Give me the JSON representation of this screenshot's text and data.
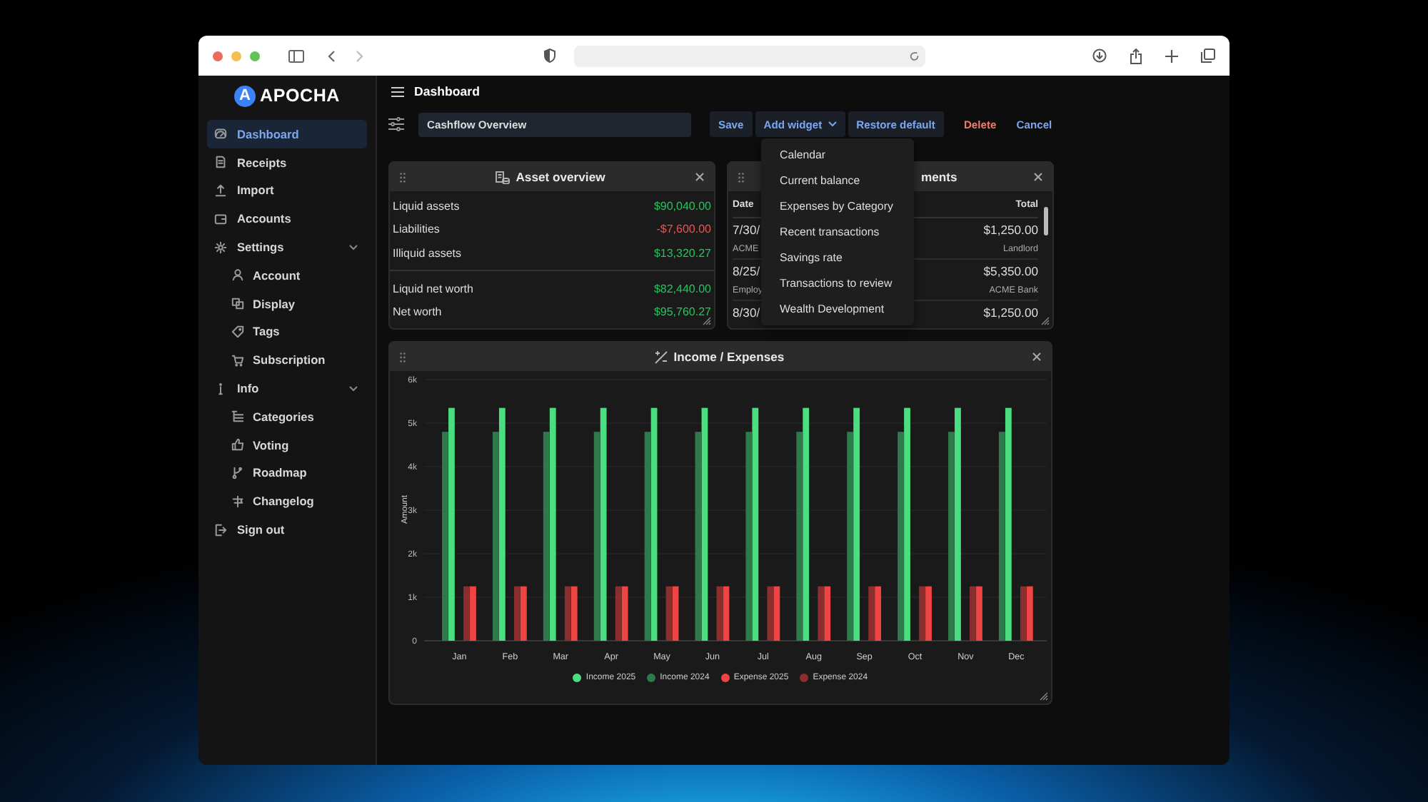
{
  "app": {
    "logo_letter": "A",
    "logo_text": "APOCHA"
  },
  "sidebar": {
    "items": [
      {
        "label": "Dashboard",
        "selected": true
      },
      {
        "label": "Receipts",
        "selected": false
      },
      {
        "label": "Import",
        "selected": false
      },
      {
        "label": "Accounts",
        "selected": false
      },
      {
        "label": "Settings",
        "selected": false,
        "expanded": true,
        "children": [
          {
            "label": "Account",
            "selected": false
          },
          {
            "label": "Display",
            "selected": false
          },
          {
            "label": "Tags",
            "selected": false
          },
          {
            "label": "Subscription",
            "selected": false
          }
        ]
      },
      {
        "label": "Info",
        "selected": false,
        "expanded": true,
        "children": [
          {
            "label": "Categories",
            "selected": false
          },
          {
            "label": "Voting",
            "selected": false
          },
          {
            "label": "Roadmap",
            "selected": false
          },
          {
            "label": "Changelog",
            "selected": false
          }
        ]
      },
      {
        "label": "Sign out",
        "selected": false
      }
    ]
  },
  "header": {
    "title": "Dashboard"
  },
  "toolbar": {
    "dashboard_name": "Cashflow Overview",
    "buttons": [
      {
        "label": "Save",
        "kind": "primary"
      },
      {
        "label": "Add widget",
        "kind": "menu"
      },
      {
        "label": "Restore default",
        "kind": "primary"
      },
      {
        "label": "Delete",
        "kind": "danger"
      },
      {
        "label": "Cancel",
        "kind": "link"
      }
    ]
  },
  "add_widget_menu": {
    "items": [
      "Calendar",
      "Current balance",
      "Expenses by Category",
      "Recent transactions",
      "Savings rate",
      "Transactions to review",
      "Wealth Development"
    ]
  },
  "asset_overview": {
    "title": "Asset overview",
    "groups": [
      [
        {
          "label": "Liquid assets",
          "value": "$90,040.00",
          "color": "#22c55e"
        },
        {
          "label": "Liabilities",
          "value": "-$7,600.00",
          "color": "#ef5350"
        },
        {
          "label": "Illiquid assets",
          "value": "$13,320.27",
          "color": "#22c55e"
        }
      ],
      [
        {
          "label": "Liquid net worth",
          "value": "$82,440.00",
          "color": "#22c55e"
        },
        {
          "label": "Net worth",
          "value": "$95,760.27",
          "color": "#22c55e"
        }
      ]
    ]
  },
  "payments": {
    "title": "ments",
    "columns": [
      "Date",
      "Total"
    ],
    "rows": [
      {
        "date": "7/30/",
        "total": "$1,250.00",
        "note": "ACME",
        "party": "Landlord"
      },
      {
        "date": "8/25/",
        "total": "$5,350.00",
        "note": "Employ",
        "party": "ACME Bank"
      },
      {
        "date": "8/30/",
        "total": "$1,250.00"
      }
    ]
  },
  "income_expenses": {
    "title": "Income / Expenses",
    "chart_data": {
      "type": "bar",
      "ylabel": "Amount",
      "categories": [
        "Jan",
        "Feb",
        "Mar",
        "Apr",
        "May",
        "Jun",
        "Jul",
        "Aug",
        "Sep",
        "Oct",
        "Nov",
        "Dec"
      ],
      "series": [
        {
          "name": "Income 2025",
          "color": "#4ade80",
          "values": [
            5350,
            5350,
            5350,
            5350,
            5350,
            5350,
            5350,
            5350,
            5350,
            5350,
            5350,
            5350
          ]
        },
        {
          "name": "Income 2024",
          "color": "#2f7a4a",
          "values": [
            4800,
            4800,
            4800,
            4800,
            4800,
            4800,
            4800,
            4800,
            4800,
            4800,
            4800,
            4800
          ]
        },
        {
          "name": "Expense 2025",
          "color": "#ef4444",
          "values": [
            1250,
            1250,
            1250,
            1250,
            1250,
            1250,
            1250,
            1250,
            1250,
            1250,
            1250,
            1250
          ]
        },
        {
          "name": "Expense 2024",
          "color": "#8b2e2e",
          "values": [
            1250,
            1250,
            1250,
            1250,
            1250,
            1250,
            1250,
            1250,
            1250,
            1250,
            1250,
            1250
          ]
        }
      ],
      "grid": true,
      "legend": "bottom",
      "ylim": [
        0,
        6000
      ],
      "yticks": [
        {
          "value": 0,
          "label": "0"
        },
        {
          "value": 1000,
          "label": "1k"
        },
        {
          "value": 2000,
          "label": "2k"
        },
        {
          "value": 3000,
          "label": "3k"
        },
        {
          "value": 4000,
          "label": "4k"
        },
        {
          "value": 5000,
          "label": "5k"
        },
        {
          "value": 6000,
          "label": "6k"
        }
      ]
    }
  }
}
